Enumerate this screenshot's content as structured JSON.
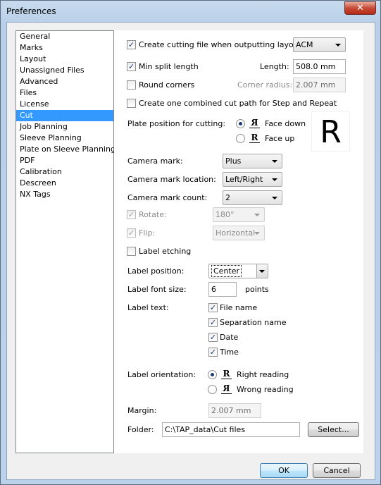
{
  "window": {
    "title": "Preferences",
    "close_glyph": "✕"
  },
  "nav": {
    "items": [
      "General",
      "Marks",
      "Layout",
      "Unassigned Files",
      "Advanced",
      "Files",
      "License",
      "Cut",
      "Job Planning",
      "Sleeve Planning",
      "Plate on Sleeve Planning",
      "PDF",
      "Calibration",
      "Descreen",
      "NX Tags"
    ],
    "selected_index": 7
  },
  "cut": {
    "create_cutting_file": {
      "label": "Create cutting file when outputting layout:",
      "checked": true,
      "format": "ACM"
    },
    "min_split": {
      "label": "Min split length",
      "checked": true,
      "length_label": "Length:",
      "length_value": "508.0 mm"
    },
    "round_corners": {
      "label": "Round corners",
      "checked": false,
      "radius_label": "Corner radius:",
      "radius_value": "2.007 mm"
    },
    "combined_cut_path": {
      "label": "Create one combined cut path for Step and Repeat",
      "checked": false
    },
    "plate_position": {
      "label": "Plate position for cutting:",
      "options": [
        {
          "glyph": "R",
          "label": "Face down",
          "selected": true
        },
        {
          "glyph": "R",
          "label": "Face up",
          "selected": false
        }
      ],
      "preview_glyph": "R"
    },
    "camera_mark": {
      "label": "Camera mark:",
      "value": "Plus"
    },
    "camera_mark_location": {
      "label": "Camera mark location:",
      "value": "Left/Right"
    },
    "camera_mark_count": {
      "label": "Camera mark count:",
      "value": "2"
    },
    "rotate": {
      "label": "Rotate:",
      "checked": true,
      "value": "180°"
    },
    "flip": {
      "label": "Flip:",
      "checked": true,
      "value": "Horizontal"
    },
    "label_etching": {
      "label": "Label etching",
      "checked": false
    },
    "label_position": {
      "label": "Label position:",
      "value": "Center"
    },
    "label_font_size": {
      "label": "Label font size:",
      "value": "6",
      "unit": "points"
    },
    "label_text": {
      "label": "Label text:",
      "options": [
        {
          "label": "File name",
          "checked": true
        },
        {
          "label": "Separation name",
          "checked": true
        },
        {
          "label": "Date",
          "checked": true
        },
        {
          "label": "Time",
          "checked": true
        }
      ]
    },
    "label_orientation": {
      "label": "Label orientation:",
      "options": [
        {
          "glyph": "R",
          "label": "Right reading",
          "selected": true
        },
        {
          "glyph": "R",
          "label": "Wrong reading",
          "selected": false
        }
      ]
    },
    "margin": {
      "label": "Margin:",
      "value": "2.007 mm"
    },
    "folder": {
      "label": "Folder:",
      "value": "C:\\TAP_data\\Cut files",
      "select_label": "Select..."
    }
  },
  "footer": {
    "ok_label": "OK",
    "cancel_label": "Cancel"
  },
  "check_glyph": "✓"
}
